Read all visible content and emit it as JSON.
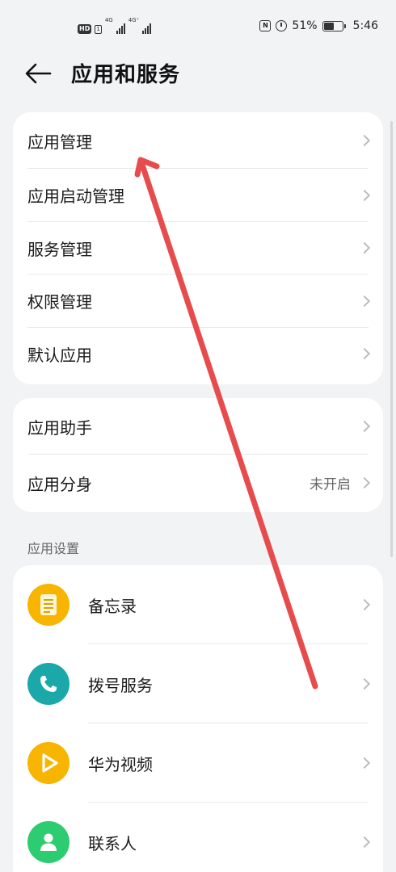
{
  "status_bar": {
    "hd": "HD",
    "sim": "1",
    "net1": "4G",
    "net2": "4G⁺",
    "battery": "51%",
    "time": "5:46"
  },
  "header": {
    "title": "应用和服务"
  },
  "group1": {
    "items": [
      {
        "label": "应用管理"
      },
      {
        "label": "应用启动管理"
      },
      {
        "label": "服务管理"
      },
      {
        "label": "权限管理"
      },
      {
        "label": "默认应用"
      }
    ]
  },
  "group2": {
    "items": [
      {
        "label": "应用助手",
        "value": ""
      },
      {
        "label": "应用分身",
        "value": "未开启"
      }
    ]
  },
  "app_settings": {
    "title": "应用设置",
    "apps": [
      {
        "label": "备忘录",
        "icon": "notepad-icon",
        "color": "#f7b500"
      },
      {
        "label": "拨号服务",
        "icon": "phone-icon",
        "color": "#1aa8a8"
      },
      {
        "label": "华为视频",
        "icon": "play-icon",
        "color": "#f7b500"
      },
      {
        "label": "联系人",
        "icon": "contacts-icon",
        "color": "#2ecc71"
      }
    ]
  },
  "annotation": {
    "arrow_color": "#e74c4c"
  }
}
